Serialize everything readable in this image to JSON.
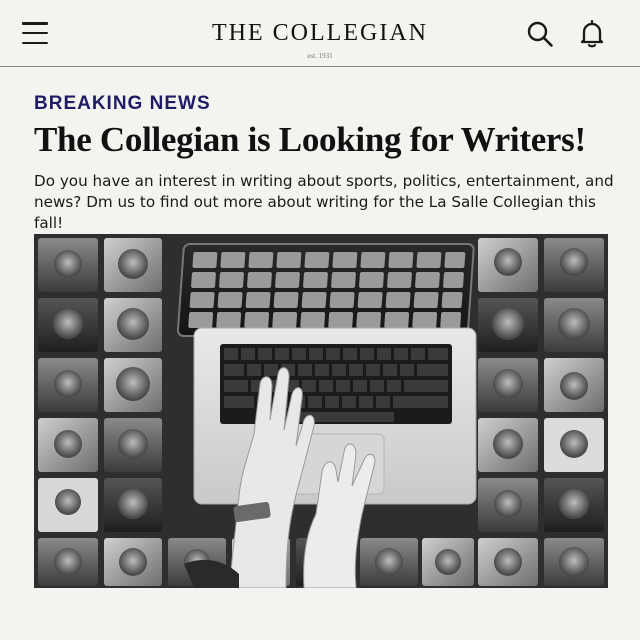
{
  "header": {
    "masthead": "THE COLLEGIAN",
    "est": "est. 1931",
    "menu_icon": "hamburger-menu-icon",
    "search_icon": "search-icon",
    "bell_icon": "bell-icon"
  },
  "article": {
    "kicker": "BREAKING NEWS",
    "headline": "The Collegian is Looking for Writers!",
    "dek": "Do you have an interest in writing about sports, politics, entertainment, and news? Dm us to find out more about writing for the La Salle Collegian this fall!"
  },
  "colors": {
    "background": "#f3f3ef",
    "kicker": "#1f1c66",
    "text": "#111111"
  }
}
